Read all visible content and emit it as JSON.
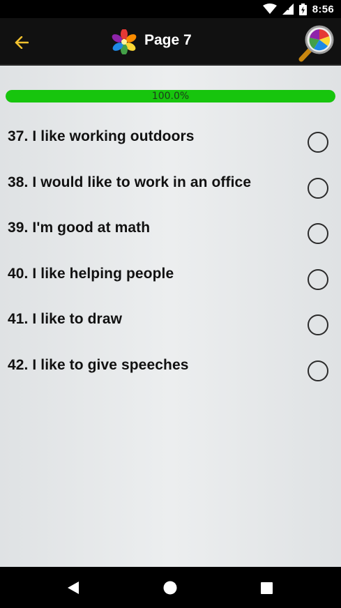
{
  "status_bar": {
    "time": "8:56",
    "icons": [
      "wifi-icon",
      "cell-signal-icon",
      "battery-icon"
    ]
  },
  "app_bar": {
    "title": "Page 7",
    "back_icon": "arrow-left-icon",
    "logo_icon": "flower-logo-icon",
    "search_icon": "magnifier-icon",
    "accent_color": "#f2c12e"
  },
  "progress": {
    "label": "100.0%",
    "fraction": 1.0,
    "fill_color": "#17c50d"
  },
  "questions": [
    {
      "label": "37. I like working outdoors",
      "selected": false
    },
    {
      "label": "38. I would like to work in an office",
      "selected": false
    },
    {
      "label": "39. I'm good at math",
      "selected": false
    },
    {
      "label": "40. I like helping people",
      "selected": false
    },
    {
      "label": "41. I like to draw",
      "selected": false
    },
    {
      "label": "42. I like to give speeches",
      "selected": false
    }
  ],
  "nav_bar": {
    "buttons": [
      "back-triangle-icon",
      "home-circle-icon",
      "recents-square-icon"
    ]
  }
}
